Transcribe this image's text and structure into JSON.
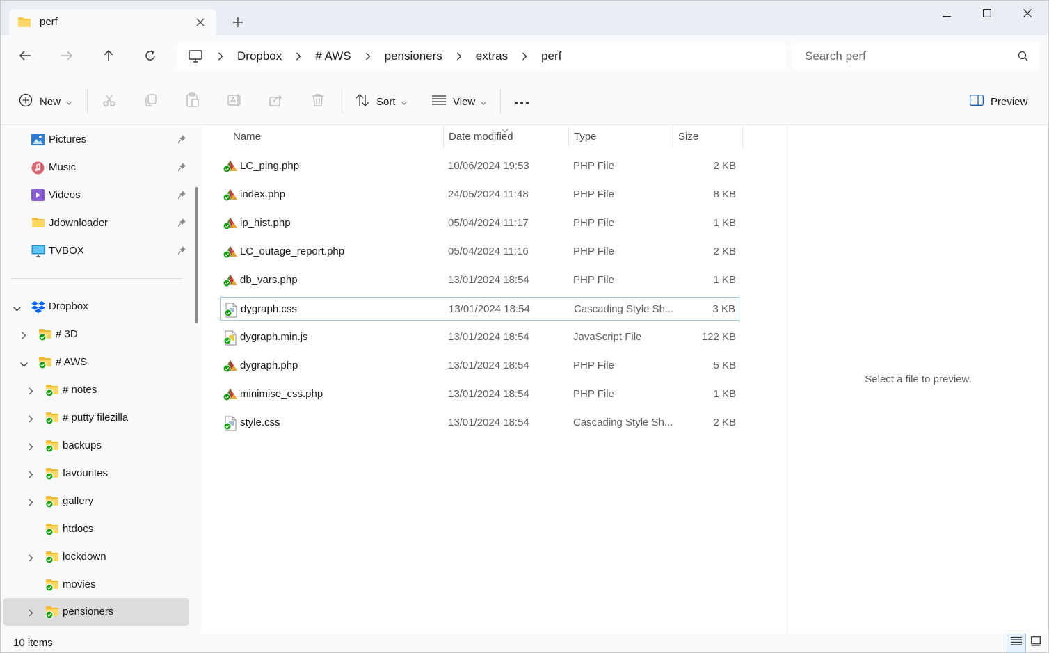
{
  "window": {
    "tab_title": "perf",
    "tab_icon": "folder-icon",
    "controls": [
      "minimize-icon",
      "maximize-icon",
      "close-icon"
    ]
  },
  "nav": {
    "buttons": [
      "back-arrow-icon",
      "forward-arrow-icon",
      "up-arrow-icon",
      "refresh-icon"
    ],
    "breadcrumb": [
      "Dropbox",
      "# AWS",
      "pensioners",
      "extras",
      "perf"
    ],
    "search_placeholder": "Search perf"
  },
  "toolbar": {
    "new_label": "New",
    "sort_label": "Sort",
    "view_label": "View",
    "preview_label": "Preview"
  },
  "sidebar": {
    "quick_access": [
      {
        "label": "Pictures",
        "icon": "pictures-icon"
      },
      {
        "label": "Music",
        "icon": "music-icon"
      },
      {
        "label": "Videos",
        "icon": "videos-icon"
      },
      {
        "label": "Jdownloader",
        "icon": "folder-icon"
      },
      {
        "label": "TVBOX",
        "icon": "monitor-icon"
      }
    ],
    "tree": [
      {
        "label": "Dropbox",
        "icon": "dropbox-icon",
        "level": 0,
        "expanded": true
      },
      {
        "label": "# 3D",
        "level": 1,
        "expanded": false
      },
      {
        "label": "# AWS",
        "level": 1,
        "expanded": true
      },
      {
        "label": "# notes",
        "level": 2,
        "expanded": false
      },
      {
        "label": "# putty filezilla",
        "level": 2,
        "expanded": false
      },
      {
        "label": "backups",
        "level": 2,
        "expanded": false
      },
      {
        "label": "favourites",
        "level": 2,
        "expanded": false
      },
      {
        "label": "gallery",
        "level": 2,
        "expanded": false
      },
      {
        "label": "htdocs",
        "level": 2,
        "no_children": true
      },
      {
        "label": "lockdown",
        "level": 2,
        "expanded": false
      },
      {
        "label": "movies",
        "level": 2,
        "no_children": true
      },
      {
        "label": "pensioners",
        "level": 2,
        "expanded": false,
        "selected": true
      }
    ]
  },
  "columns": {
    "name": "Name",
    "date": "Date modified",
    "type": "Type",
    "size": "Size"
  },
  "files": [
    {
      "name": "LC_ping.php",
      "date": "10/06/2024 19:53",
      "type": "PHP File",
      "size": "2 KB",
      "icon": "php"
    },
    {
      "name": "index.php",
      "date": "24/05/2024 11:48",
      "type": "PHP File",
      "size": "8 KB",
      "icon": "php"
    },
    {
      "name": "ip_hist.php",
      "date": "05/04/2024 11:17",
      "type": "PHP File",
      "size": "1 KB",
      "icon": "php"
    },
    {
      "name": "LC_outage_report.php",
      "date": "05/04/2024 11:16",
      "type": "PHP File",
      "size": "2 KB",
      "icon": "php"
    },
    {
      "name": "db_vars.php",
      "date": "13/01/2024 18:54",
      "type": "PHP File",
      "size": "1 KB",
      "icon": "php"
    },
    {
      "name": "dygraph.css",
      "date": "13/01/2024 18:54",
      "type": "Cascading Style Sh...",
      "size": "3 KB",
      "icon": "css",
      "focused": true
    },
    {
      "name": "dygraph.min.js",
      "date": "13/01/2024 18:54",
      "type": "JavaScript File",
      "size": "122 KB",
      "icon": "js"
    },
    {
      "name": "dygraph.php",
      "date": "13/01/2024 18:54",
      "type": "PHP File",
      "size": "5 KB",
      "icon": "php"
    },
    {
      "name": "minimise_css.php",
      "date": "13/01/2024 18:54",
      "type": "PHP File",
      "size": "1 KB",
      "icon": "php"
    },
    {
      "name": "style.css",
      "date": "13/01/2024 18:54",
      "type": "Cascading Style Sh...",
      "size": "2 KB",
      "icon": "css"
    }
  ],
  "preview_message": "Select a file to preview.",
  "status": {
    "item_count": "10 items"
  },
  "colors": {
    "sync_green": "#13a10e",
    "folder_yellow": "#f8c842",
    "selection_gray": "#dcdcdc",
    "focus_border": "#99c9ef"
  }
}
